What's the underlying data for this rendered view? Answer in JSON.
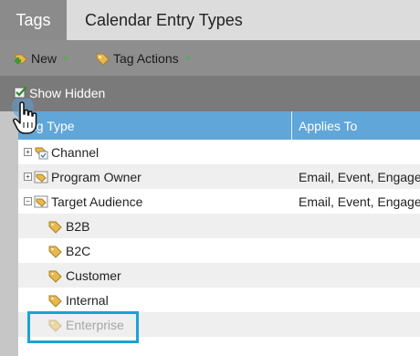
{
  "tabs": [
    {
      "label": "Tags",
      "active": true
    },
    {
      "label": "Calendar Entry Types",
      "active": false
    }
  ],
  "toolbar": {
    "new_label": "New",
    "tag_actions_label": "Tag Actions"
  },
  "show_hidden": {
    "label": "Show Hidden",
    "checked": true
  },
  "table": {
    "columns": [
      "Tag Type",
      "Applies To"
    ],
    "rows": [
      {
        "name": "Channel",
        "applies_to": "",
        "level": 0,
        "expander": "+"
      },
      {
        "name": "Program Owner",
        "applies_to": "Email, Event, Engagem",
        "level": 0,
        "expander": "+"
      },
      {
        "name": "Target Audience",
        "applies_to": "Email, Event, Engagem",
        "level": 0,
        "expander": "-"
      },
      {
        "name": "B2B",
        "applies_to": "",
        "level": 1
      },
      {
        "name": "B2C",
        "applies_to": "",
        "level": 1
      },
      {
        "name": "Customer",
        "applies_to": "",
        "level": 1
      },
      {
        "name": "Internal",
        "applies_to": "",
        "level": 1
      },
      {
        "name": "Enterprise",
        "applies_to": "",
        "level": 1,
        "hidden": true
      }
    ]
  },
  "colors": {
    "header_blue": "#60a6d8",
    "highlight": "#1aa3d6",
    "toolbar": "#8e8e8e"
  }
}
